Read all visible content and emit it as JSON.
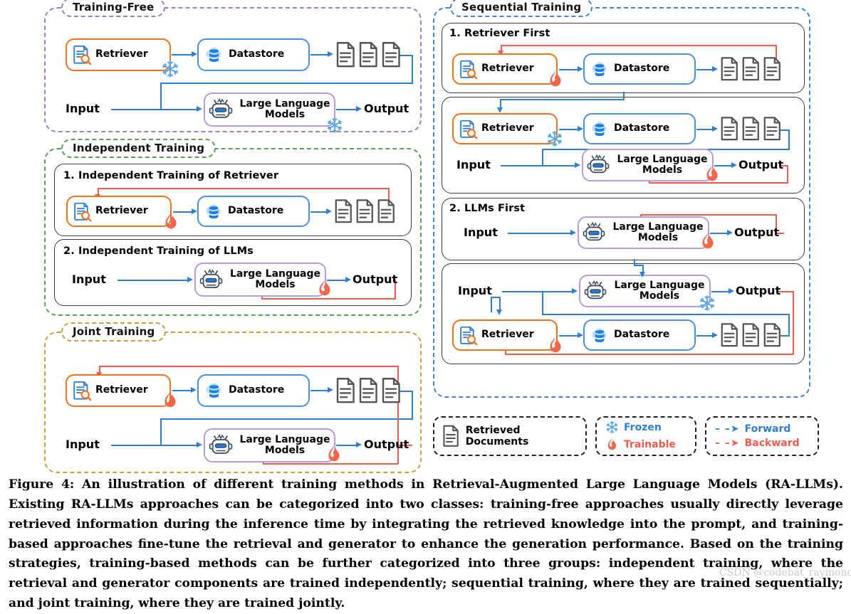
{
  "figure": {
    "left_column": [
      {
        "id": "training-free",
        "title": "Training-Free",
        "color": "#9a7fc4",
        "nodes": {
          "retriever": "Retriever",
          "datastore": "Datastore",
          "llm": "Large Language\nModels",
          "input": "Input",
          "output": "Output"
        },
        "llm_line1": "Large Language",
        "llm_line2": "Models",
        "markers": [
          "frozen-retriever",
          "frozen-llm"
        ]
      },
      {
        "id": "independent-training",
        "title": "Independent Training",
        "color": "#5a9e59",
        "subpanels": [
          {
            "title": "1. Independent Training of Retriever",
            "markers": [
              "trainable-retriever"
            ]
          },
          {
            "title": "2. Independent Training of LLMs",
            "markers": [
              "trainable-llm"
            ]
          }
        ]
      },
      {
        "id": "joint-training",
        "title": "Joint Training",
        "color": "#c7a03a",
        "markers": [
          "trainable-retriever",
          "trainable-llm"
        ]
      }
    ],
    "right_column": [
      {
        "id": "sequential-training",
        "title": "Sequential Training",
        "color": "#4a7fd4",
        "subpanels": [
          {
            "title": "1. Retriever First"
          },
          {
            "title": ""
          },
          {
            "title": "2. LLMs First"
          },
          {
            "title": ""
          }
        ]
      }
    ],
    "labels": {
      "retriever": "Retriever",
      "datastore": "Datastore",
      "llm_line1": "Large Language",
      "llm_line2": "Models",
      "input": "Input",
      "output": "Output"
    },
    "legend": {
      "documents": "Retrieved Documents",
      "frozen": "Frozen",
      "trainable": "Trainable",
      "forward": "Forward",
      "backward": "Backward",
      "dash_glyph": "– –➤"
    },
    "colors": {
      "forward_arrow": "#2f7fd0",
      "backward_arrow": "#f05a4f",
      "retriever_border": "#f2711c",
      "datastore_border": "#4a90e2",
      "llm_border": "#b39ddb",
      "document_gray": "#555555",
      "frozen_blue": "#5aa9e6",
      "flame_orange": "#f4664a"
    }
  },
  "caption": {
    "prefix": "Figure 4:",
    "text": " An illustration of different training methods in Retrieval-Augmented Large Language Models (RA-LLMs). Existing RA-LLMs approaches can be categorized into two classes: training-free approaches usually directly leverage retrieved information during the inference time by integrating the retrieved knowledge into the prompt, and training-based approaches fine-tune the retrieval and generator to enhance the generation performance. Based on the training strategies, training-based methods can be further categorized into three groups: independent training, where the retrieval and generator components are trained independently; sequential training, where they are trained sequentially; and joint training, where they are trained jointly."
  },
  "watermark": {
    "text": "CSDN @codebat_raymond"
  }
}
